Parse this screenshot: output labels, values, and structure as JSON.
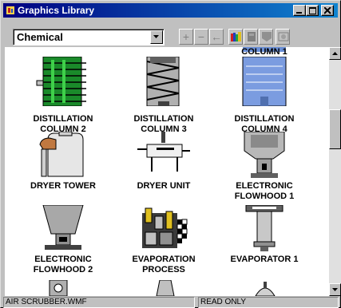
{
  "window": {
    "title": "Graphics Library"
  },
  "toolbar": {
    "category": "Chemical"
  },
  "items": [
    {
      "line1": "COLUMN 1",
      "line2": ""
    },
    {
      "line1": "DISTILLATION",
      "line2": "COLUMN 2"
    },
    {
      "line1": "DISTILLATION",
      "line2": "COLUMN 3"
    },
    {
      "line1": "DISTILLATION",
      "line2": "COLUMN 4"
    },
    {
      "line1": "DRYER TOWER",
      "line2": ""
    },
    {
      "line1": "DRYER UNIT",
      "line2": ""
    },
    {
      "line1": "ELECTRONIC",
      "line2": "FLOWHOOD 1"
    },
    {
      "line1": "ELECTRONIC",
      "line2": "FLOWHOOD 2"
    },
    {
      "line1": "EVAPORATION",
      "line2": "PROCESS"
    },
    {
      "line1": "EVAPORATOR 1",
      "line2": ""
    }
  ],
  "statusbar": {
    "file": "AIR SCRUBBER.WMF",
    "mode": "READ ONLY"
  },
  "icons": {
    "minimize": "minimize-icon",
    "maximize": "maximize-icon",
    "close": "close-icon",
    "add": "plus-icon",
    "remove": "minus-icon",
    "back": "arrow-left-icon"
  },
  "colors": {
    "titlebar_start": "#000080",
    "titlebar_end": "#1084d0",
    "face": "#c0c0c0"
  }
}
